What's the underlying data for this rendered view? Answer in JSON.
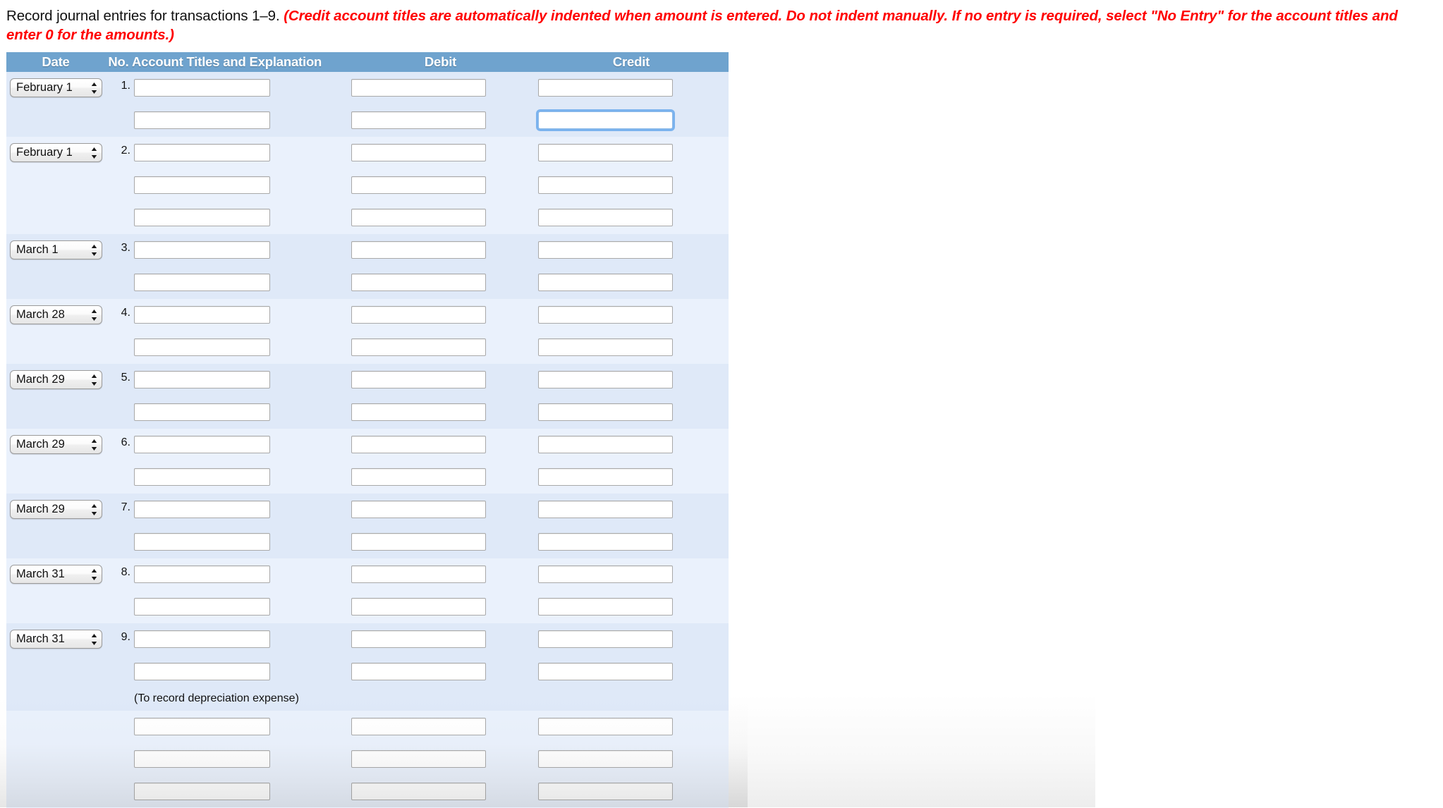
{
  "prompt": {
    "lead": "Record journal entries for transactions 1–9.",
    "note": "(Credit account titles are automatically indented when amount is entered. Do not indent manually. If no entry is required, select \"No Entry\" for the account titles and enter 0 for the amounts.)"
  },
  "table": {
    "headers": {
      "date": "Date",
      "no": "No.",
      "account": "Account Titles and Explanation",
      "debit": "Debit",
      "credit": "Credit"
    },
    "colors": {
      "header_bg": "#6fa3ce",
      "stripe_a": "#dfe9f8",
      "stripe_b": "#eaf1fc",
      "focus_ring": "#5aa0eb",
      "note_text": "#ff0000"
    },
    "entries": [
      {
        "no": "1.",
        "date": "February 1",
        "stripe": "a",
        "lines": [
          {
            "account": "",
            "debit": "",
            "credit": "",
            "credit_focused": false
          },
          {
            "account": "",
            "debit": "",
            "credit": "",
            "credit_focused": true
          }
        ],
        "memo": ""
      },
      {
        "no": "2.",
        "date": "February 1",
        "stripe": "b",
        "lines": [
          {
            "account": "",
            "debit": "",
            "credit": "",
            "credit_focused": false
          },
          {
            "account": "",
            "debit": "",
            "credit": "",
            "credit_focused": false
          },
          {
            "account": "",
            "debit": "",
            "credit": "",
            "credit_focused": false
          }
        ],
        "memo": ""
      },
      {
        "no": "3.",
        "date": "March 1",
        "stripe": "a",
        "lines": [
          {
            "account": "",
            "debit": "",
            "credit": "",
            "credit_focused": false
          },
          {
            "account": "",
            "debit": "",
            "credit": "",
            "credit_focused": false
          }
        ],
        "memo": ""
      },
      {
        "no": "4.",
        "date": "March 28",
        "stripe": "b",
        "lines": [
          {
            "account": "",
            "debit": "",
            "credit": "",
            "credit_focused": false
          },
          {
            "account": "",
            "debit": "",
            "credit": "",
            "credit_focused": false
          }
        ],
        "memo": ""
      },
      {
        "no": "5.",
        "date": "March 29",
        "stripe": "a",
        "lines": [
          {
            "account": "",
            "debit": "",
            "credit": "",
            "credit_focused": false
          },
          {
            "account": "",
            "debit": "",
            "credit": "",
            "credit_focused": false
          }
        ],
        "memo": ""
      },
      {
        "no": "6.",
        "date": "March 29",
        "stripe": "b",
        "lines": [
          {
            "account": "",
            "debit": "",
            "credit": "",
            "credit_focused": false
          },
          {
            "account": "",
            "debit": "",
            "credit": "",
            "credit_focused": false
          }
        ],
        "memo": ""
      },
      {
        "no": "7.",
        "date": "March 29",
        "stripe": "a",
        "lines": [
          {
            "account": "",
            "debit": "",
            "credit": "",
            "credit_focused": false
          },
          {
            "account": "",
            "debit": "",
            "credit": "",
            "credit_focused": false
          }
        ],
        "memo": ""
      },
      {
        "no": "8.",
        "date": "March 31",
        "stripe": "b",
        "lines": [
          {
            "account": "",
            "debit": "",
            "credit": "",
            "credit_focused": false
          },
          {
            "account": "",
            "debit": "",
            "credit": "",
            "credit_focused": false
          }
        ],
        "memo": ""
      },
      {
        "no": "9.",
        "date": "March 31",
        "stripe": "a",
        "lines": [
          {
            "account": "",
            "debit": "",
            "credit": "",
            "credit_focused": false
          },
          {
            "account": "",
            "debit": "",
            "credit": "",
            "credit_focused": false
          }
        ],
        "memo": "(To record depreciation expense)"
      },
      {
        "no": "",
        "date": "",
        "stripe": "b",
        "lines": [
          {
            "account": "",
            "debit": "",
            "credit": "",
            "credit_focused": false
          },
          {
            "account": "",
            "debit": "",
            "credit": "",
            "credit_focused": false
          },
          {
            "account": "",
            "debit": "",
            "credit": "",
            "credit_focused": false
          }
        ],
        "memo": ""
      }
    ]
  },
  "icons": {
    "stepper": "up-down-stepper-icon"
  }
}
